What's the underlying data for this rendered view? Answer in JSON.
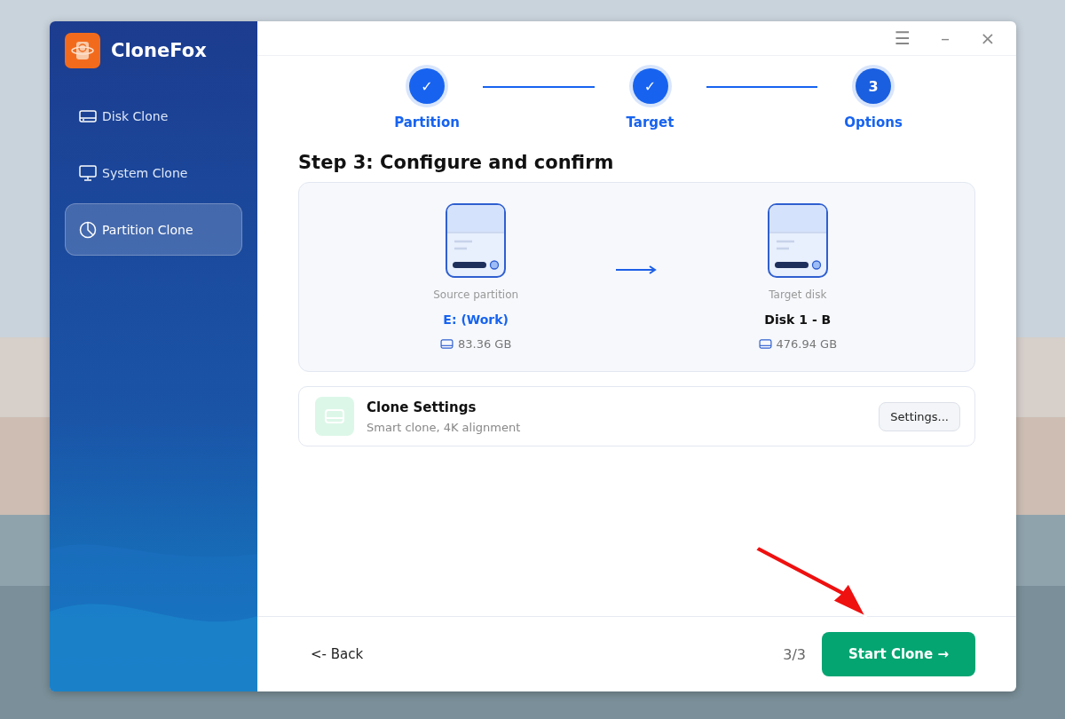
{
  "app": {
    "name": "CloneFox"
  },
  "sidebar": {
    "items": [
      {
        "label": "Disk Clone",
        "kind": "disk",
        "selected": false
      },
      {
        "label": "System Clone",
        "kind": "monitor",
        "selected": false
      },
      {
        "label": "Partition Clone",
        "kind": "pie",
        "selected": true
      }
    ]
  },
  "titlebar": {
    "menu": "☰",
    "minimize": "–",
    "close": "×"
  },
  "steps": [
    {
      "mark": "✓",
      "label": "Partition",
      "kind": "done"
    },
    {
      "mark": "✓",
      "label": "Target",
      "kind": "done"
    },
    {
      "mark": "3",
      "label": "Options",
      "kind": "current"
    }
  ],
  "heading": "Step 3: Configure and confirm",
  "source": {
    "caption": "Source partition",
    "name": "E: (Work)",
    "size": "83.36 GB",
    "highlight": true
  },
  "target": {
    "caption": "Target disk",
    "name": "Disk 1 - B",
    "size": "476.94 GB",
    "highlight": false
  },
  "settings": {
    "title": "Clone Settings",
    "subtitle": "Smart clone, 4K alignment",
    "button": "Settings..."
  },
  "footer": {
    "back": "<- Back",
    "page": "3/3",
    "start": "Start Clone →"
  },
  "annotation": {
    "kind": "arrow"
  }
}
